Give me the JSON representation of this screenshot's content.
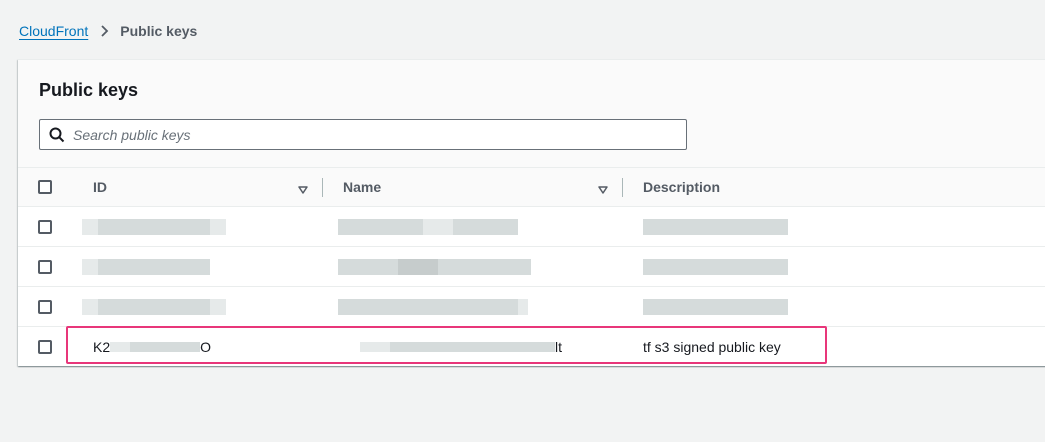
{
  "breadcrumb": {
    "root": "CloudFront",
    "current": "Public keys"
  },
  "panel": {
    "title": "Public keys",
    "search_placeholder": "Search public keys"
  },
  "table": {
    "columns": [
      "ID",
      "Name",
      "Description"
    ],
    "rows": [
      {
        "id_prefix": "",
        "id_suffix": "",
        "name_suffix": "",
        "description": ""
      },
      {
        "id_prefix": "",
        "id_suffix": "",
        "name_suffix": "",
        "description": ""
      },
      {
        "id_prefix": "",
        "id_suffix": "",
        "name_suffix": "",
        "description": ""
      },
      {
        "id_prefix": "K2",
        "id_suffix": "O",
        "name_suffix": "lt",
        "description": "tf s3 signed public key"
      }
    ]
  },
  "colors": {
    "link": "#0073bb",
    "highlight": "#e8367a",
    "background": "#f2f3f3"
  },
  "icons": [
    "chevron-right-icon",
    "search-icon",
    "sort-caret-icon"
  ]
}
